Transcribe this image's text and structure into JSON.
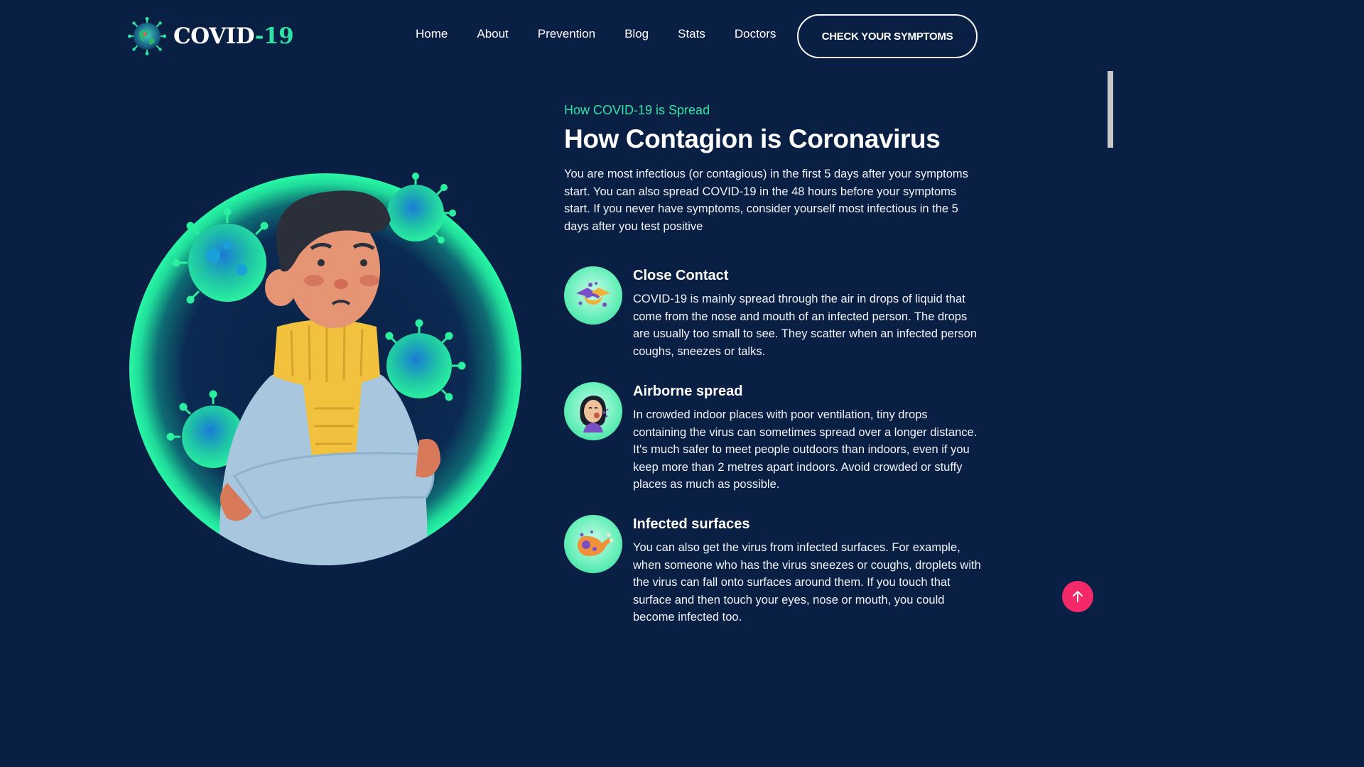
{
  "header": {
    "logo": {
      "word": "COVID",
      "dash": "-",
      "number": "19"
    },
    "nav": [
      "Home",
      "About",
      "Prevention",
      "Blog",
      "Stats",
      "Doctors"
    ],
    "cta_label": "CHECK YOUR SYMPTOMS"
  },
  "section": {
    "eyebrow": "How COVID-19 is Spread",
    "title": "How Contagion is Coronavirus",
    "intro": "You are most infectious (or contagious) in the first 5 days after your symptoms start. You can also spread COVID-19 in the 48 hours before your symptoms start. If you never have symptoms, consider yourself most infectious in the 5 days after you test positive",
    "features": [
      {
        "icon": "handshake-icon",
        "title": "Close Contact",
        "text": "COVID-19 is mainly spread through the air in drops of liquid that come from the nose and mouth of an infected person. The drops are usually too small to see. They scatter when an infected person coughs, sneezes or talks."
      },
      {
        "icon": "coughing-woman-icon",
        "title": "Airborne spread",
        "text": "In crowded indoor places with poor ventilation, tiny drops containing the virus can sometimes spread over a longer distance. It's much safer to meet people outdoors than indoors, even if you keep more than 2 metres apart indoors. Avoid crowded or stuffy places as much as possible."
      },
      {
        "icon": "infected-food-icon",
        "title": "Infected surfaces",
        "text": "You can also get the virus from infected surfaces. For example, when someone who has the virus sneezes or coughs, droplets with the virus can fall onto surfaces around them. If you touch that surface and then touch your eyes, nose or mouth, you could become infected too."
      }
    ]
  },
  "colors": {
    "background": "#0a1f44",
    "accent": "#2fe3a4",
    "scroll_top_button": "#f4296a"
  }
}
